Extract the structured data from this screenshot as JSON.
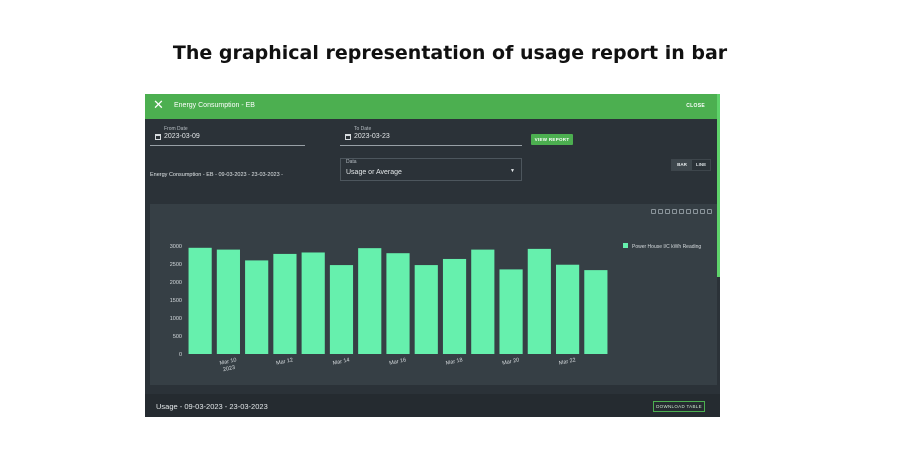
{
  "page_caption": "The graphical representation of usage report in bar",
  "topbar": {
    "close_icon": "close-icon",
    "title": "Energy Consumption - EB",
    "close_label": "CLOSE",
    "color": "#4caf50"
  },
  "filters": {
    "from_label": "From Date",
    "from_value": "2023-03-09",
    "to_label": "To Date",
    "to_value": "2023-03-23",
    "view_report_label": "VIEW REPORT",
    "data_label": "Data",
    "data_value": "Usage or Average",
    "toggle_bar": "BAR",
    "toggle_line": "LINE"
  },
  "chart_title": "Energy Consumption - EB - 09-03-2023 - 23-03-2023 -",
  "bottom": {
    "usage_label": "Usage - 09-03-2023 - 23-03-2023",
    "download_label": "DOWNLOAD TABLE"
  },
  "chart_data": {
    "type": "bar",
    "categories": [
      "2023-03-09",
      "2023-03-10",
      "2023-03-11",
      "2023-03-12",
      "2023-03-13",
      "2023-03-14",
      "2023-03-15",
      "2023-03-16",
      "2023-03-17",
      "2023-03-18",
      "2023-03-19",
      "2023-03-20",
      "2023-03-21",
      "2023-03-22",
      "2023-03-23"
    ],
    "x_tick_labels": [
      {
        "index": 1,
        "label": "Mar 10",
        "sublabel": "2023"
      },
      {
        "index": 3,
        "label": "Mar 12",
        "sublabel": ""
      },
      {
        "index": 5,
        "label": "Mar 14",
        "sublabel": ""
      },
      {
        "index": 7,
        "label": "Mar 16",
        "sublabel": ""
      },
      {
        "index": 9,
        "label": "Mar 18",
        "sublabel": ""
      },
      {
        "index": 11,
        "label": "Mar 20",
        "sublabel": ""
      },
      {
        "index": 13,
        "label": "Mar 22",
        "sublabel": ""
      }
    ],
    "series": [
      {
        "name": "Power House I/C kWh Reading",
        "color": "#66f0ad",
        "values": [
          2950,
          2900,
          2600,
          2780,
          2820,
          2470,
          2940,
          2800,
          2470,
          2640,
          2900,
          2350,
          2920,
          2480,
          2330
        ]
      }
    ],
    "y_ticks": [
      0,
      500,
      1000,
      1500,
      2000,
      2500,
      3000
    ],
    "ylim": [
      0,
      3000
    ],
    "legend_position": "top-right",
    "grid": false
  }
}
